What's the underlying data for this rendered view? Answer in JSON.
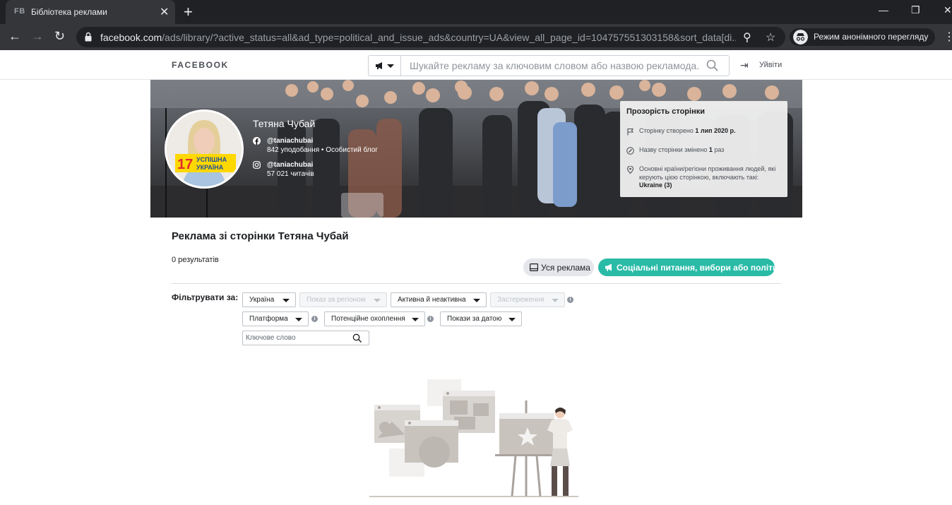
{
  "browser": {
    "tab_favicon": "FB",
    "tab_title": "Бібліотека реклами",
    "url_host": "facebook.com",
    "url_path": "/ads/library/?active_status=all&ad_type=political_and_issue_ads&country=UA&view_all_page_id=104757551303158&sort_data[di...",
    "incognito_label": "Режим анонімного перегляду"
  },
  "header": {
    "logo": "FACEBOOK",
    "search_placeholder": "Шукайте рекламу за ключовим словом або назвою рекламода...",
    "logout_label": "Уйвіти"
  },
  "page": {
    "name": "Тетяна Чубай",
    "facebook_handle": "@taniachubai",
    "facebook_stats": "842 уподобання • Особистий блог",
    "instagram_handle": "@taniachubai",
    "instagram_stats": "57 021 читачів",
    "avatar_number": "17",
    "avatar_text_1": "УСПІШНА",
    "avatar_text_2": "УКРАЇНА"
  },
  "transparency": {
    "title": "Прозорість сторінки",
    "created_prefix": "Сторінку створено ",
    "created_date": "1 лип 2020 р.",
    "renamed_prefix": "Назву сторінки змінено ",
    "renamed_count": "1",
    "renamed_suffix": " раз",
    "countries_text": "Основні країни/регіони проживання людей, які керують цією сторінкою, включають такі: ",
    "countries_value": "Ukraine (3)"
  },
  "content": {
    "heading": "Реклама зі сторінки Тетяна Чубай",
    "results": "0 результатів",
    "btn_all": "Уся реклама",
    "btn_social": "Соціальні питання, вибори або політика",
    "filter_label": "Фільтрувати за:"
  },
  "filters": {
    "country": "Україна",
    "region": "Показ за регіоном",
    "status": "Активна й неактивна",
    "disclaimer": "Застереження",
    "platform": "Платформа",
    "reach": "Потенційне охоплення",
    "date": "Покази за датою",
    "keyword_placeholder": "Ключове слово"
  },
  "colors": {
    "accent": "#2abba7",
    "chrome_dark": "#202124",
    "chrome_bar": "#35363a"
  }
}
